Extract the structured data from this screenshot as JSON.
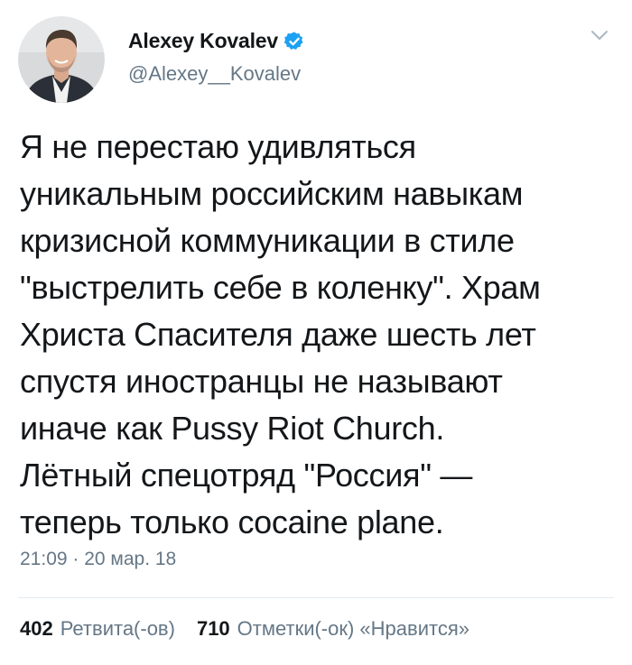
{
  "author": {
    "name": "Alexey Kovalev",
    "handle": "@Alexey__Kovalev",
    "verified": true,
    "verified_color": "#1da1f2"
  },
  "tweet": {
    "lines": [
      "Я не перестаю удивляться",
      "уникальным российским навыкам",
      "кризисной коммуникации в стиле",
      "\"выстрелить себе в коленку\". Храм",
      "Христа Спасителя даже шесть лет",
      "спустя иностранцы не называют",
      "иначе как Pussy Riot Church.",
      "Лётный спецотряд \"Россия\" —",
      "теперь только cocaine plane."
    ],
    "timestamp": "21:09 · 20 мар. 18"
  },
  "stats": {
    "retweets_count": "402",
    "retweets_label": "Ретвита(-ов)",
    "likes_count": "710",
    "likes_label": "Отметки(-ок) «Нравится»"
  },
  "icons": {
    "verified": "verified-badge-icon",
    "menu": "chevron-down-icon"
  },
  "colors": {
    "text": "#14171a",
    "secondary": "#657786",
    "divider": "#e1e8ed"
  }
}
